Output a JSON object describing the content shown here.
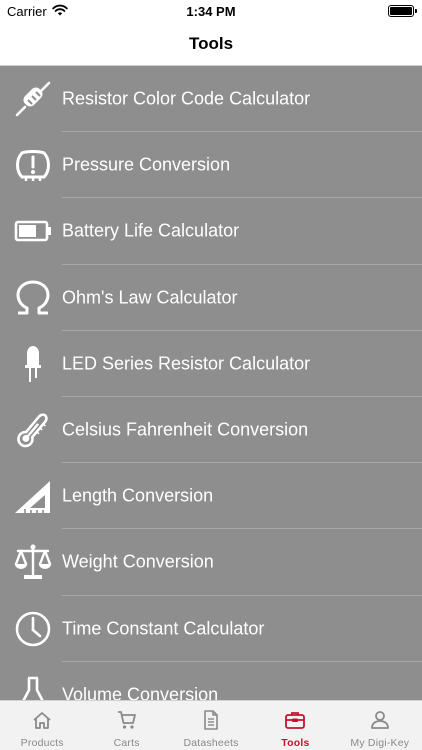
{
  "status_bar": {
    "carrier": "Carrier",
    "time": "1:34 PM"
  },
  "nav": {
    "title": "Tools"
  },
  "tools": [
    {
      "label": "Resistor Color Code Calculator",
      "icon": "resistor-icon"
    },
    {
      "label": "Pressure Conversion",
      "icon": "tire-pressure-icon"
    },
    {
      "label": "Battery Life Calculator",
      "icon": "battery-icon"
    },
    {
      "label": "Ohm's Law Calculator",
      "icon": "omega-icon"
    },
    {
      "label": "LED Series Resistor Calculator",
      "icon": "led-icon"
    },
    {
      "label": "Celsius Fahrenheit Conversion",
      "icon": "thermometer-icon"
    },
    {
      "label": "Length Conversion",
      "icon": "triangle-ruler-icon"
    },
    {
      "label": "Weight Conversion",
      "icon": "scale-icon"
    },
    {
      "label": "Time Constant Calculator",
      "icon": "clock-icon"
    },
    {
      "label": "Volume Conversion",
      "icon": "flask-icon"
    }
  ],
  "tab_bar": {
    "tabs": [
      {
        "label": "Products",
        "icon": "home-icon"
      },
      {
        "label": "Carts",
        "icon": "cart-icon"
      },
      {
        "label": "Datasheets",
        "icon": "document-icon"
      },
      {
        "label": "Tools",
        "icon": "toolbox-icon",
        "active": true
      },
      {
        "label": "My Digi-Key",
        "icon": "person-icon"
      }
    ],
    "active_color": "#c8102e",
    "inactive_color": "#8a8a8a"
  },
  "colors": {
    "list_background": "#8e8e8e",
    "list_text": "#ffffff",
    "bar_background": "#ffffff"
  }
}
